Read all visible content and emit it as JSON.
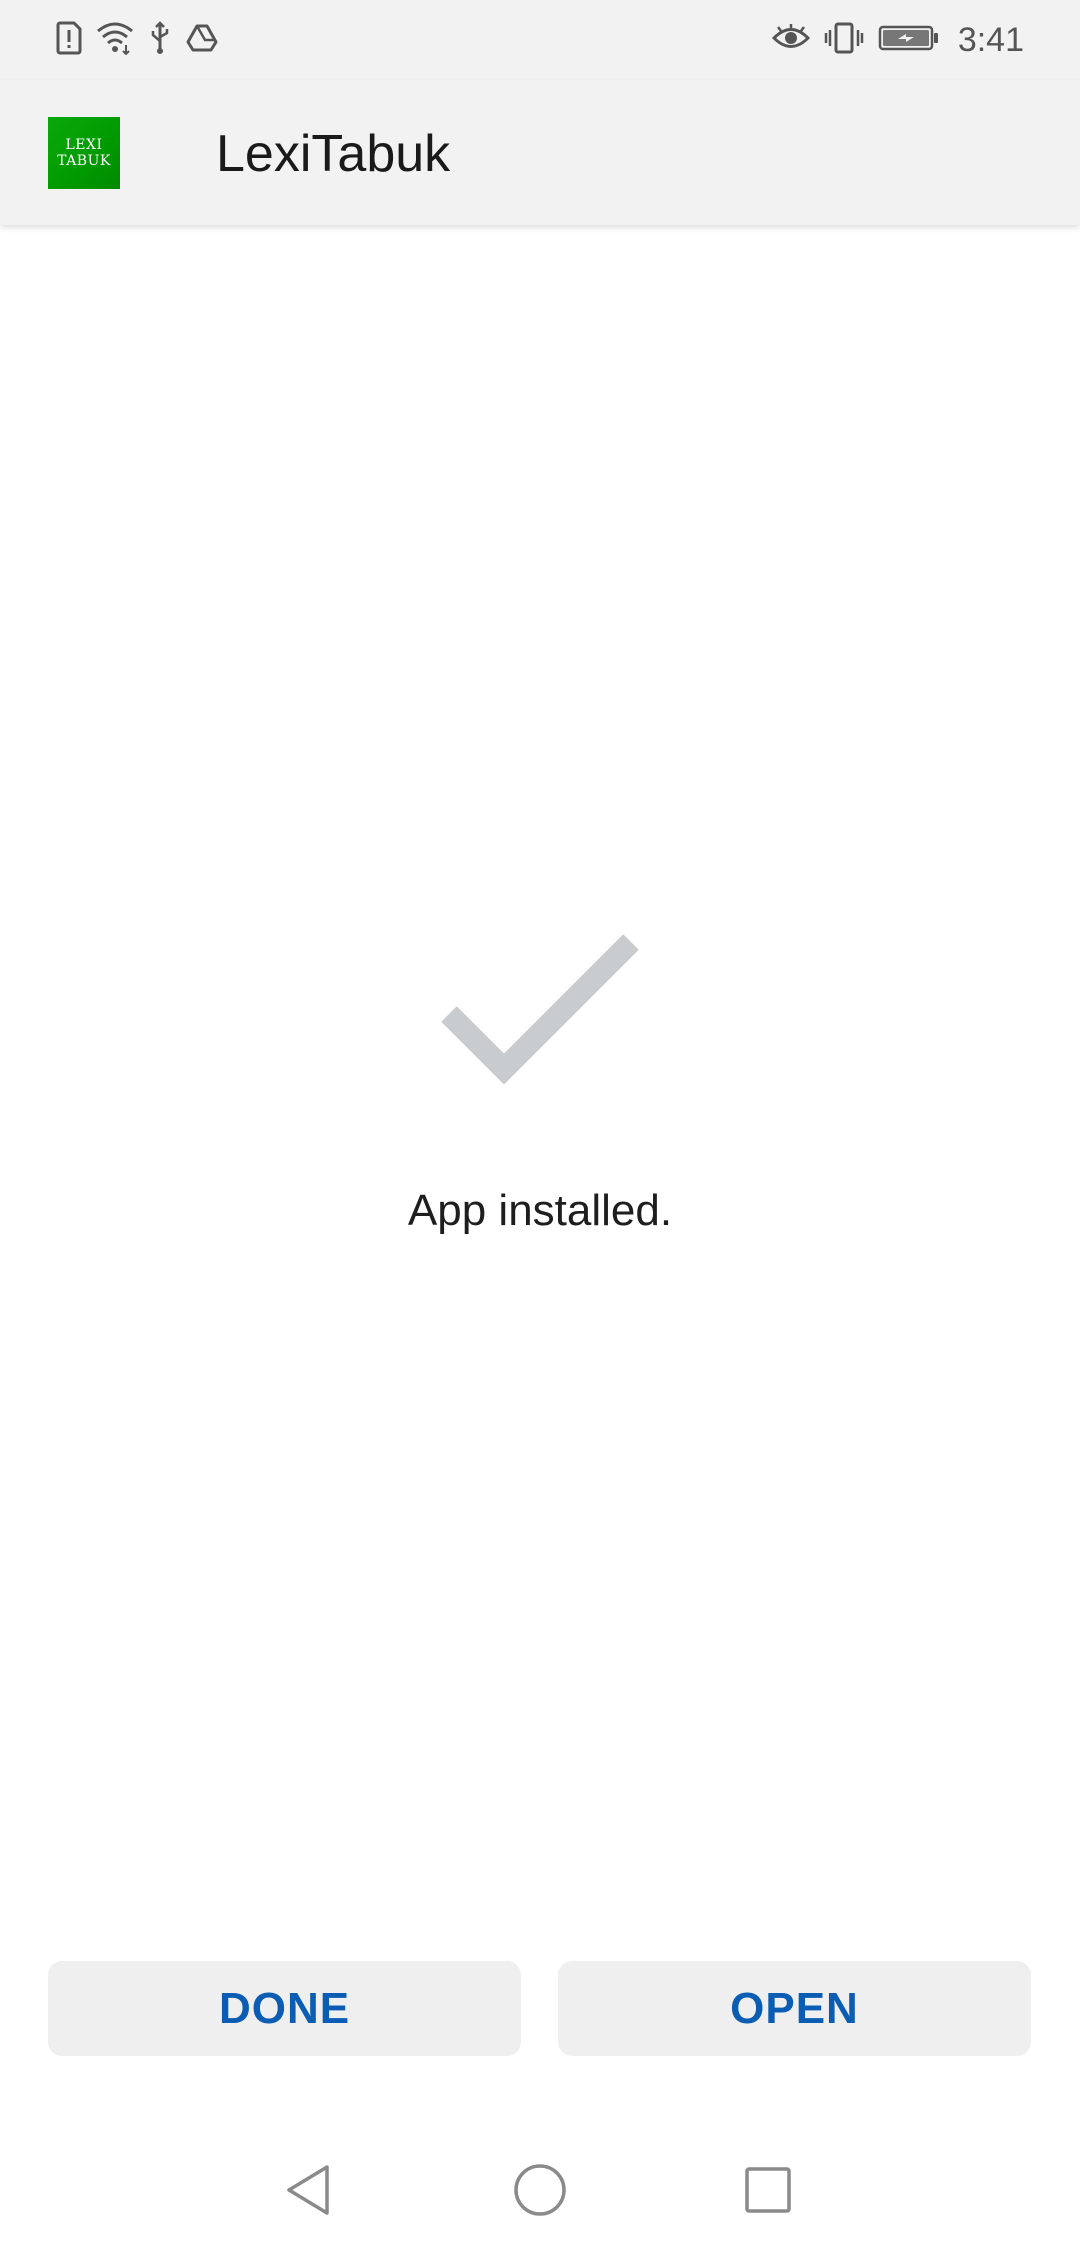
{
  "status_bar": {
    "time": "3:41",
    "left_icons": [
      "sim-alert-icon",
      "wifi-icon",
      "usb-icon",
      "drive-icon"
    ],
    "right_icons": [
      "eye-icon",
      "vibrate-icon",
      "battery-charging-icon"
    ]
  },
  "app_bar": {
    "logo_line1": "LEXI",
    "logo_line2": "TABUK",
    "title": "LexiTabuk"
  },
  "main": {
    "icon": "checkmark-icon",
    "message": "App installed."
  },
  "actions": {
    "done_label": "DONE",
    "open_label": "OPEN"
  },
  "nav_bar": {
    "icons": [
      "back-icon",
      "home-icon",
      "recents-icon"
    ]
  },
  "colors": {
    "accent": "#0a5db3",
    "logo_green": "#009a00",
    "checkmark": "#c9cccf",
    "bar_background": "#f2f2f2"
  }
}
